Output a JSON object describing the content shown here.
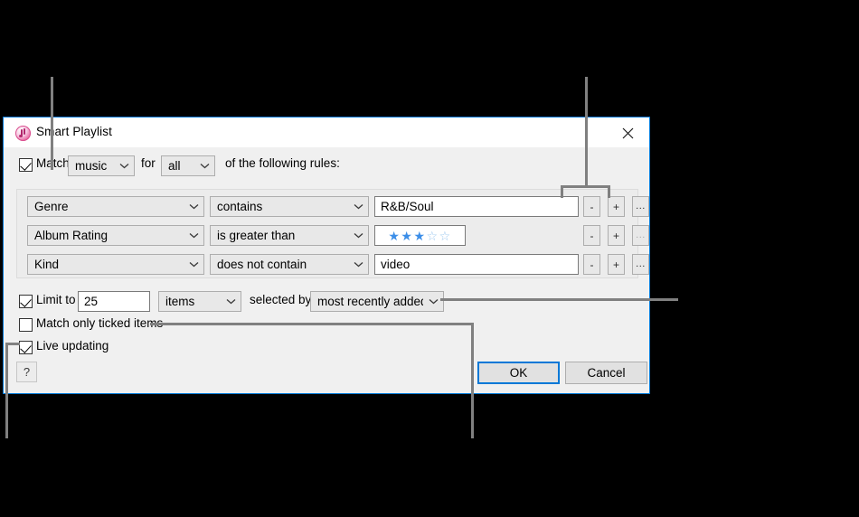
{
  "dialog": {
    "title": "Smart Playlist",
    "icon": "itunes-app-icon",
    "close_icon": "close-icon"
  },
  "match_row": {
    "checkbox_checked": true,
    "label_match": "Match",
    "media_type": "music",
    "label_for": "for",
    "quantifier": "all",
    "label_suffix": "of the following rules:"
  },
  "rules": [
    {
      "field": "Genre",
      "operator": "contains",
      "value_kind": "text",
      "value": "R&B/Soul",
      "remove_label": "-",
      "add_label": "+",
      "more_label": "...",
      "more_dim": false
    },
    {
      "field": "Album Rating",
      "operator": "is greater than",
      "value_kind": "stars",
      "stars_filled": 3,
      "stars_total": 5,
      "remove_label": "-",
      "add_label": "+",
      "more_label": "...",
      "more_dim": true
    },
    {
      "field": "Kind",
      "operator": "does not contain",
      "value_kind": "text",
      "value": "video",
      "remove_label": "-",
      "add_label": "+",
      "more_label": "...",
      "more_dim": false
    }
  ],
  "options": {
    "limit_checked": true,
    "limit_label": "Limit to",
    "limit_value": "25",
    "limit_units": "items",
    "selected_by_label": "selected by",
    "selected_by_value": "most recently added",
    "ticked_checked": false,
    "ticked_label": "Match only ticked items",
    "live_checked": true,
    "live_label": "Live updating"
  },
  "buttons": {
    "help_label": "?",
    "ok_label": "OK",
    "cancel_label": "Cancel"
  },
  "colors": {
    "accent": "#0078d7",
    "star": "#3c8ee8",
    "star_empty": "#9dc8f0",
    "dialog_bg": "#f0f0f0",
    "callout": "#808080"
  }
}
